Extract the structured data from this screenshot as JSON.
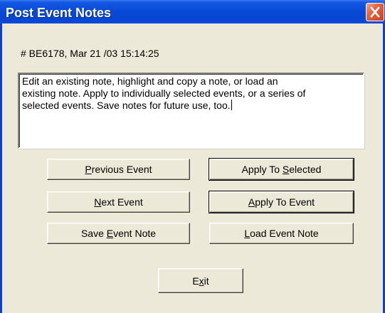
{
  "window": {
    "title": "Post Event Notes",
    "close_icon": "close-icon",
    "title_color": "#0a4ad8",
    "close_color": "#e5633d"
  },
  "event": {
    "id_line": "# BE6178, Mar 21 /03 15:14:25"
  },
  "note": {
    "lines": [
      "Edit an existing note, highlight and copy a note, or load an",
      "existing note.  Apply to individually selected events, or a series of",
      "selected events.  Save notes for future use, too."
    ]
  },
  "buttons": {
    "previous_event": {
      "pre": "",
      "accel": "P",
      "post": "revious Event"
    },
    "apply_to_selected": {
      "pre": "Apply To ",
      "accel": "S",
      "post": "elected"
    },
    "next_event": {
      "pre": "",
      "accel": "N",
      "post": "ext Event"
    },
    "apply_to_event": {
      "pre": "",
      "accel": "A",
      "post": "pply To Event"
    },
    "save_event_note": {
      "pre": "Save ",
      "accel": "E",
      "post": "vent Note"
    },
    "load_event_note": {
      "pre": "",
      "accel": "L",
      "post": "oad Event Note"
    },
    "exit": {
      "pre": "E",
      "accel": "x",
      "post": "it"
    }
  }
}
